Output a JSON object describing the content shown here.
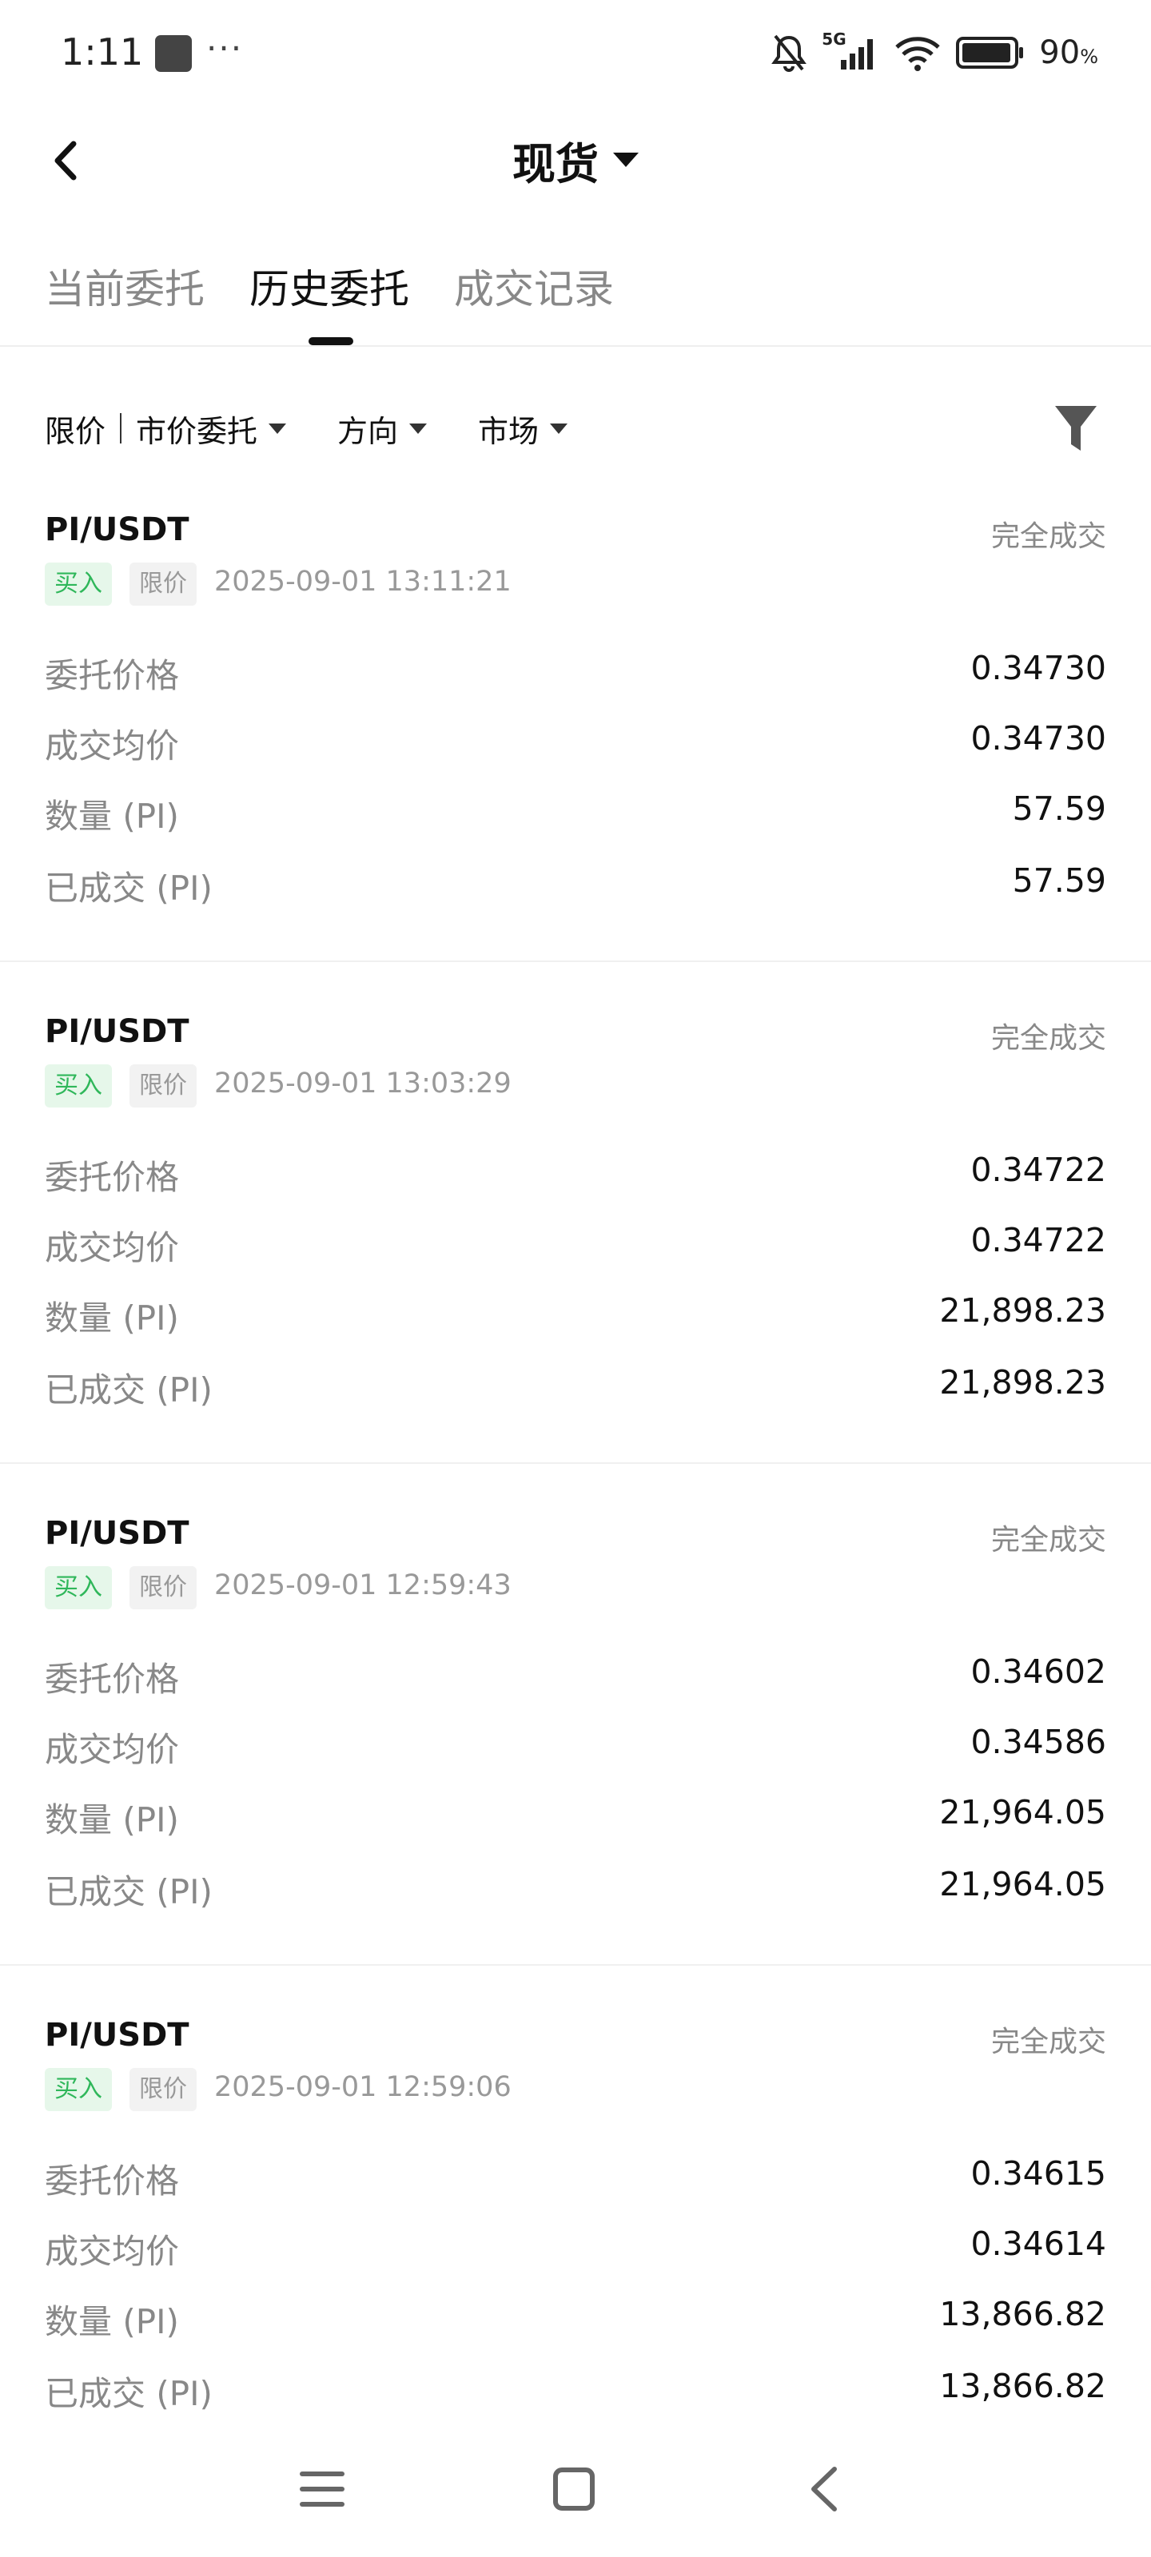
{
  "status_bar": {
    "time": "1:11",
    "dots": "···",
    "network": "5G",
    "battery_percent": "90",
    "battery_unit": "%",
    "icons": [
      "mute-bell-icon",
      "signal-icon",
      "wifi-icon",
      "battery-icon"
    ]
  },
  "header": {
    "title": "现货",
    "back_icon": "chevron-left-icon",
    "title_dropdown_icon": "caret-down-icon"
  },
  "tabs": [
    {
      "label": "当前委托",
      "active": false
    },
    {
      "label": "历史委托",
      "active": true
    },
    {
      "label": "成交记录",
      "active": false
    }
  ],
  "filters": {
    "order_type": "限价",
    "order_type_alt": "市价委托",
    "direction": "方向",
    "market": "市场",
    "filter_icon": "funnel-icon"
  },
  "labels": {
    "order_price": "委托价格",
    "avg_price": "成交均价",
    "quantity": "数量 (PI)",
    "filled": "已成交 (PI)"
  },
  "orders": [
    {
      "pair": "PI/USDT",
      "status": "完全成交",
      "side": "买入",
      "type": "限价",
      "time": "2025-09-01 13:11:21",
      "order_price": "0.34730",
      "avg_price": "0.34730",
      "quantity": "57.59",
      "filled": "57.59"
    },
    {
      "pair": "PI/USDT",
      "status": "完全成交",
      "side": "买入",
      "type": "限价",
      "time": "2025-09-01 13:03:29",
      "order_price": "0.34722",
      "avg_price": "0.34722",
      "quantity": "21,898.23",
      "filled": "21,898.23"
    },
    {
      "pair": "PI/USDT",
      "status": "完全成交",
      "side": "买入",
      "type": "限价",
      "time": "2025-09-01 12:59:43",
      "order_price": "0.34602",
      "avg_price": "0.34586",
      "quantity": "21,964.05",
      "filled": "21,964.05"
    },
    {
      "pair": "PI/USDT",
      "status": "完全成交",
      "side": "买入",
      "type": "限价",
      "time": "2025-09-01 12:59:06",
      "order_price": "0.34615",
      "avg_price": "0.34614",
      "quantity": "13,866.82",
      "filled": "13,866.82"
    }
  ],
  "colors": {
    "buy_green": "#2fb75a",
    "buy_bg": "#e6f7ea",
    "muted_text": "#888888",
    "primary_text": "#111111"
  },
  "system_nav": {
    "icons": [
      "menu-icon",
      "home-icon",
      "back-icon"
    ]
  }
}
